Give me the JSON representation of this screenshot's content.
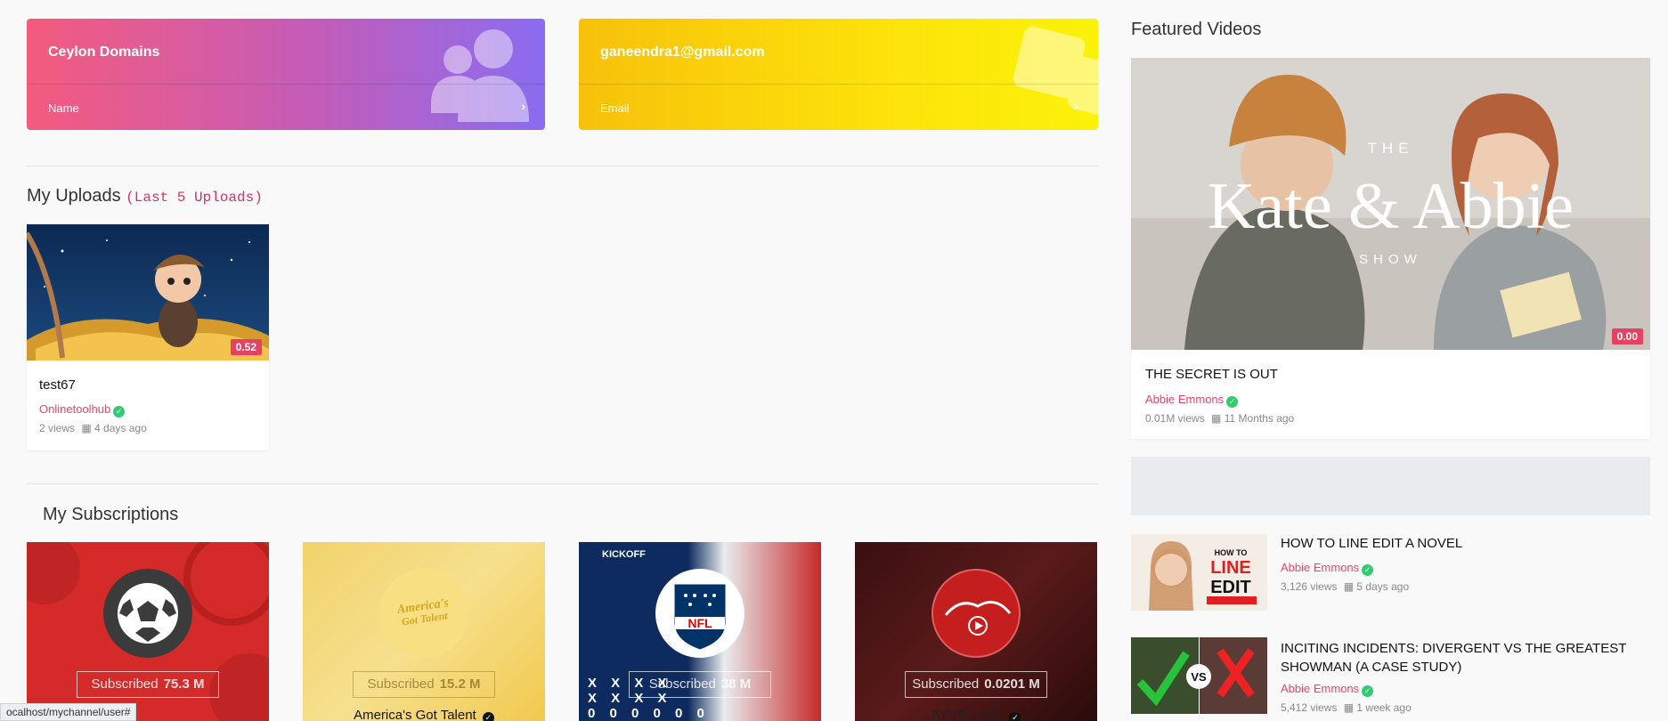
{
  "stats": {
    "name": {
      "value": "Ceylon Domains",
      "caption": "Name"
    },
    "email": {
      "value": "ganeendra1@gmail.com",
      "caption": "Email"
    }
  },
  "uploads": {
    "heading": "My Uploads",
    "subheading": "(Last 5 Uploads)",
    "items": [
      {
        "title": "test67",
        "channel": "Onlinetoolhub",
        "views": "2 views",
        "age": "4 days ago",
        "duration": "0.52"
      }
    ]
  },
  "subscriptions": {
    "heading": "My Subscriptions",
    "button_label": "Subscribed",
    "items": [
      {
        "count": "75.3 M",
        "name": ""
      },
      {
        "count": "15.2 M",
        "name": "America's Got Talent"
      },
      {
        "count": "38 M",
        "name": ""
      },
      {
        "count": "0.0201 M",
        "name": "AYUBO one"
      }
    ]
  },
  "featured": {
    "heading": "Featured Videos",
    "main": {
      "title": "THE SECRET IS OUT",
      "channel": "Abbie Emmons",
      "views": "0.01M views",
      "age": "11 Months ago",
      "duration": "0.00",
      "thumb_text_top": "THE",
      "thumb_text_main": "Kate & Abbie",
      "thumb_text_bottom": "SHOW"
    },
    "list": [
      {
        "title": "HOW TO LINE EDIT A NOVEL",
        "channel": "Abbie Emmons",
        "views": "3,126 views",
        "age": "5 days ago"
      },
      {
        "title": "INCITING INCIDENTS: DIVERGENT VS THE GREATEST SHOWMAN (A CASE STUDY)",
        "channel": "Abbie Emmons",
        "views": "5,412 views",
        "age": "1 week ago"
      }
    ]
  },
  "statusbar": {
    "url": "ocalhost/mychannel/user#"
  },
  "colors": {
    "accent": "#e8476a",
    "verified": "#2fcc71",
    "badge": "#e44263"
  }
}
